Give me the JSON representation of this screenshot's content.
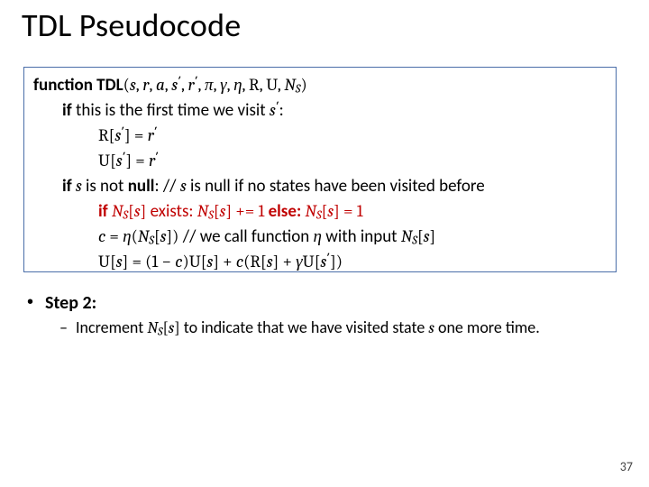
{
  "title": "TDL Pseudocode",
  "code": {
    "fn_kw": "function TDL",
    "params_open": "(",
    "p1": "s",
    "c1": ", ",
    "p2": "r",
    "c2": ", ",
    "p3": "a",
    "c3": ", ",
    "p4": "s",
    "p4p": "′",
    "c4": ", ",
    "p5": "r",
    "p5p": "′",
    "c5": ", ",
    "p6": "π",
    "c6": ", ",
    "p7": "γ",
    "c7": ", ",
    "p8": "η",
    "c8": ", ",
    "p9": "R",
    "c9": ", ",
    "p10": "U",
    "c10": ", ",
    "p11a": "N",
    "p11b": "S",
    "params_close": ")",
    "if1_kw": "if",
    "if1_txt": " this is the first time we visit ",
    "if1_s": "s",
    "if1_sp": "′",
    "if1_colon": ":",
    "l3_R": "R",
    "l3_open": "[",
    "l3_s": "s",
    "l3_sp": "′",
    "l3_close": "] = ",
    "l3_r": "r",
    "l3_rp": "′",
    "l4_U": "U",
    "l4_open": "[",
    "l4_s": "s",
    "l4_sp": "′",
    "l4_close": "] = ",
    "l4_r": "r",
    "l4_rp": "′",
    "if2_kw": "if",
    "if2_s": " s ",
    "if2_txt": "is not ",
    "if2_null": "null",
    "if2_colon": ":",
    "if2_cmt_slashes": "   // ",
    "if2_cmt_s": "s",
    "if2_cmt_rest": " is null if no states have been visited before",
    "red_if": "if ",
    "red_N": "N",
    "red_Nsub": "S",
    "red_brk_open": "[",
    "red_s1": "s",
    "red_brk_close": "]",
    "red_exists": " exists: ",
    "red_N2": "N",
    "red_N2sub": "S",
    "red_brk2_open": "[",
    "red_s2": "s",
    "red_brk2_close": "]",
    "red_pluseq": " += 1 ",
    "red_else": "else: ",
    "red_N3": "N",
    "red_N3sub": "S",
    "red_brk3_open": "[",
    "red_s3": "s",
    "red_brk3_close": "]",
    "red_eq1": " = 1",
    "l7_c": "c",
    "l7_eq": " = ",
    "l7_eta": "η",
    "l7_po": "(",
    "l7_N": "N",
    "l7_Nsub": "S",
    "l7_bo": "[",
    "l7_s": "s",
    "l7_bc": "]",
    "l7_pc": ")",
    "l7_cmt_slashes": "    // we call function ",
    "l7_cmt_eta": "η",
    "l7_cmt_mid": " with input ",
    "l7_cmt_N": "N",
    "l7_cmt_Nsub": "S",
    "l7_cmt_bo": "[",
    "l7_cmt_s": "s",
    "l7_cmt_bc": "]",
    "l8_U": "U",
    "l8_bo": "[",
    "l8_s": "s",
    "l8_bc": "] =  (1 − ",
    "l8_c1": "c",
    "l8_mid1": ")",
    "l8_U2": "U",
    "l8_bo2": "[",
    "l8_s2": "s",
    "l8_bc2": "] + ",
    "l8_c2": "c",
    "l8_po": "(",
    "l8_R": "R",
    "l8_bo3": "[",
    "l8_s3": "s",
    "l8_bc3": "] + ",
    "l8_g": "γ",
    "l8_U3": "U",
    "l8_bo4": "[",
    "l8_s4": "s",
    "l8_s4p": "′",
    "l8_bc4": "])"
  },
  "step2": {
    "bullet": "•",
    "label": "Step 2:",
    "dash": "–",
    "txt1": "Increment ",
    "N": "N",
    "Nsub": "S",
    "bo": "[",
    "s": "s",
    "bc": "]",
    "txt2": " to indicate that we have visited state ",
    "s2": "s",
    "txt3": " one more time."
  },
  "page_number": "37"
}
